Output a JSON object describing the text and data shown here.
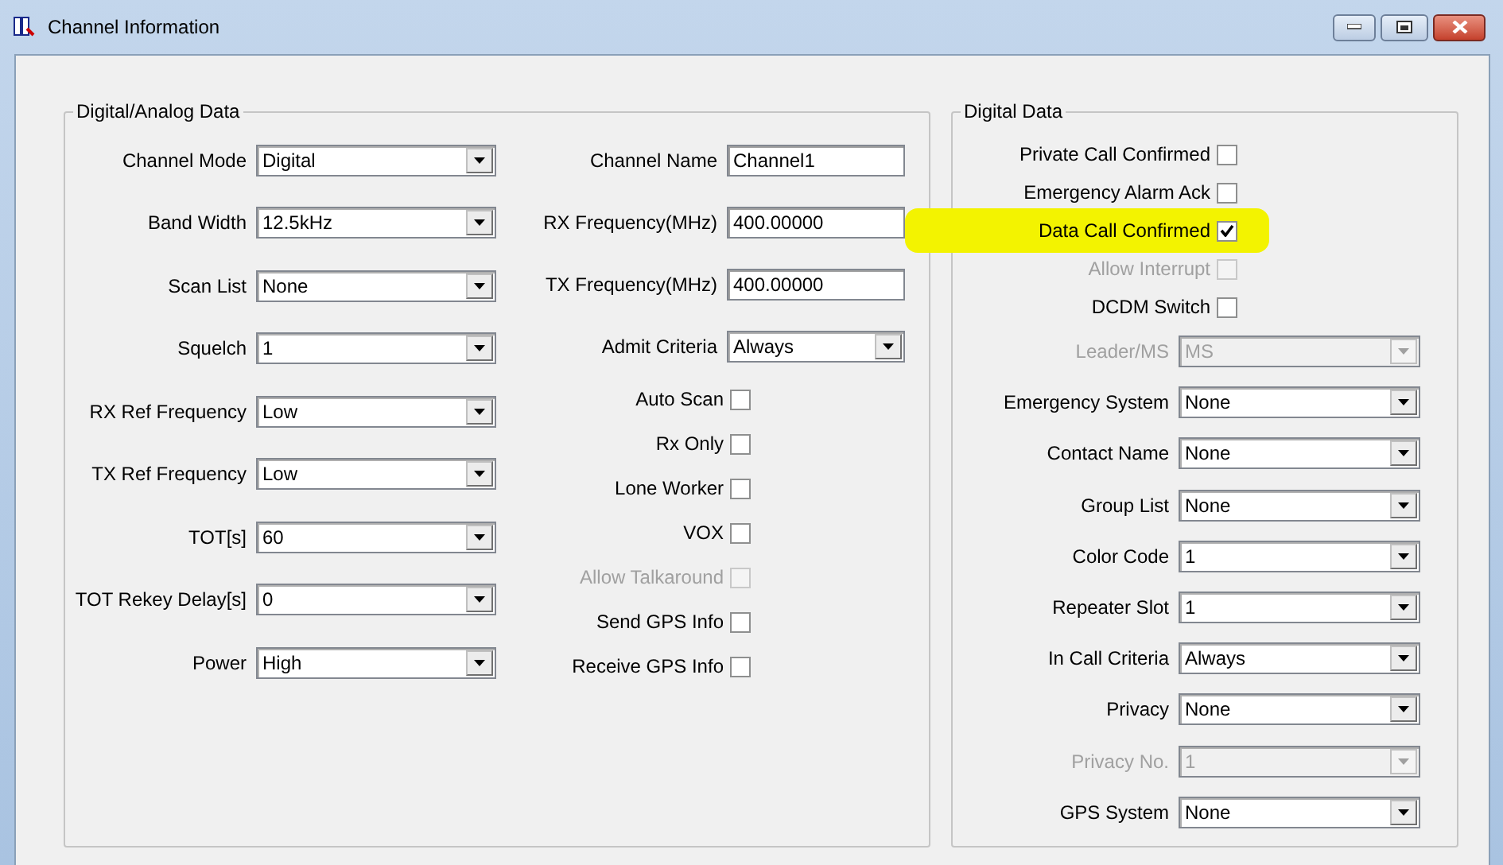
{
  "window": {
    "title": "Channel Information"
  },
  "groups": [
    {
      "title": "Digital/Analog Data",
      "columns": [
        [
          {
            "kind": "select",
            "label": "Channel Mode",
            "value": "Digital",
            "disabled": false
          },
          {
            "kind": "select",
            "label": "Band Width",
            "value": "12.5kHz",
            "disabled": false
          },
          {
            "kind": "select",
            "label": "Scan List",
            "value": "None",
            "disabled": false
          },
          {
            "kind": "select",
            "label": "Squelch",
            "value": "1",
            "disabled": false
          },
          {
            "kind": "select",
            "label": "RX Ref Frequency",
            "value": "Low",
            "disabled": false
          },
          {
            "kind": "select",
            "label": "TX Ref Frequency",
            "value": "Low",
            "disabled": false
          },
          {
            "kind": "select",
            "label": "TOT[s]",
            "value": "60",
            "disabled": false
          },
          {
            "kind": "select",
            "label": "TOT Rekey Delay[s]",
            "value": "0",
            "disabled": false
          },
          {
            "kind": "select",
            "label": "Power",
            "value": "High",
            "disabled": false
          }
        ],
        [
          {
            "kind": "text",
            "label": "Channel Name",
            "value": "Channel1"
          },
          {
            "kind": "text",
            "label": "RX Frequency(MHz)",
            "value": "400.00000"
          },
          {
            "kind": "text",
            "label": "TX Frequency(MHz)",
            "value": "400.00000"
          },
          {
            "kind": "select",
            "label": "Admit Criteria",
            "value": "Always",
            "disabled": false
          },
          {
            "kind": "checkbox",
            "label": "Auto Scan",
            "checked": false,
            "disabled": false,
            "highlighted": false
          },
          {
            "kind": "checkbox",
            "label": "Rx Only",
            "checked": false,
            "disabled": false,
            "highlighted": false
          },
          {
            "kind": "checkbox",
            "label": "Lone Worker",
            "checked": false,
            "disabled": false,
            "highlighted": false
          },
          {
            "kind": "checkbox",
            "label": "VOX",
            "checked": false,
            "disabled": false,
            "highlighted": false
          },
          {
            "kind": "checkbox",
            "label": "Allow Talkaround",
            "checked": false,
            "disabled": true,
            "highlighted": false
          },
          {
            "kind": "checkbox",
            "label": "Send GPS Info",
            "checked": false,
            "disabled": false,
            "highlighted": false
          },
          {
            "kind": "checkbox",
            "label": "Receive GPS Info",
            "checked": false,
            "disabled": false,
            "highlighted": false
          }
        ]
      ]
    },
    {
      "title": "Digital Data",
      "columns": [
        [
          {
            "kind": "checkbox",
            "label": "Private Call Confirmed",
            "checked": false,
            "disabled": false,
            "highlighted": false
          },
          {
            "kind": "checkbox",
            "label": "Emergency Alarm Ack",
            "checked": false,
            "disabled": false,
            "highlighted": false
          },
          {
            "kind": "checkbox",
            "label": "Data Call Confirmed",
            "checked": true,
            "disabled": false,
            "highlighted": true
          },
          {
            "kind": "checkbox",
            "label": "Allow Interrupt",
            "checked": false,
            "disabled": true,
            "highlighted": false
          },
          {
            "kind": "checkbox",
            "label": "DCDM Switch",
            "checked": false,
            "disabled": false,
            "highlighted": false
          },
          {
            "kind": "select",
            "label": "Leader/MS",
            "value": "MS",
            "disabled": true
          },
          {
            "kind": "select",
            "label": "Emergency System",
            "value": "None",
            "disabled": false
          },
          {
            "kind": "select",
            "label": "Contact Name",
            "value": "None",
            "disabled": false
          },
          {
            "kind": "select",
            "label": "Group List",
            "value": "None",
            "disabled": false
          },
          {
            "kind": "select",
            "label": "Color Code",
            "value": "1",
            "disabled": false
          },
          {
            "kind": "select",
            "label": "Repeater Slot",
            "value": "1",
            "disabled": false
          },
          {
            "kind": "select",
            "label": "In Call Criteria",
            "value": "Always",
            "disabled": false
          },
          {
            "kind": "select",
            "label": "Privacy",
            "value": "None",
            "disabled": false
          },
          {
            "kind": "select",
            "label": "Privacy No.",
            "value": "1",
            "disabled": true
          },
          {
            "kind": "select",
            "label": "GPS System",
            "value": "None",
            "disabled": false
          }
        ]
      ]
    }
  ]
}
